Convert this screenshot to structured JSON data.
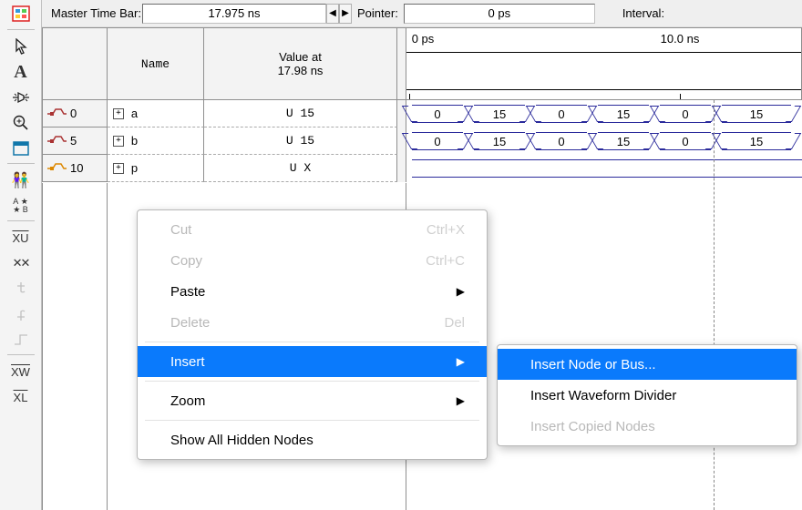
{
  "topbar": {
    "master_label": "Master Time Bar:",
    "master_value": "17.975 ns",
    "pointer_label": "Pointer:",
    "pointer_value": "0 ps",
    "interval_label": "Interval:"
  },
  "headers": {
    "name": "Name",
    "value_at_line1": "Value at",
    "value_at_line2": "17.98 ns"
  },
  "ruler": {
    "t0": "0 ps",
    "t1": "10.0 ns"
  },
  "signals": [
    {
      "idx": "0",
      "name": "a",
      "value": "U 15",
      "wave": [
        "0",
        "15",
        "0",
        "15",
        "0",
        "15"
      ]
    },
    {
      "idx": "5",
      "name": "b",
      "value": "U 15",
      "wave": [
        "0",
        "15",
        "0",
        "15",
        "0",
        "15"
      ]
    },
    {
      "idx": "10",
      "name": "p",
      "value": "U X",
      "wave": null
    }
  ],
  "context_menu": {
    "items": [
      {
        "label": "Cut",
        "shortcut": "Ctrl+X",
        "disabled": true
      },
      {
        "label": "Copy",
        "shortcut": "Ctrl+C",
        "disabled": true
      },
      {
        "label": "Paste",
        "submenu": true
      },
      {
        "label": "Delete",
        "shortcut": "Del",
        "disabled": true
      },
      null,
      {
        "label": "Insert",
        "submenu": true,
        "selected": true
      },
      null,
      {
        "label": "Zoom",
        "submenu": true
      },
      null,
      {
        "label": "Show All Hidden Nodes"
      }
    ],
    "insert_submenu": [
      {
        "label": "Insert Node or Bus...",
        "selected": true
      },
      {
        "label": "Insert Waveform Divider"
      },
      {
        "label": "Insert Copied Nodes",
        "disabled": true
      }
    ]
  }
}
